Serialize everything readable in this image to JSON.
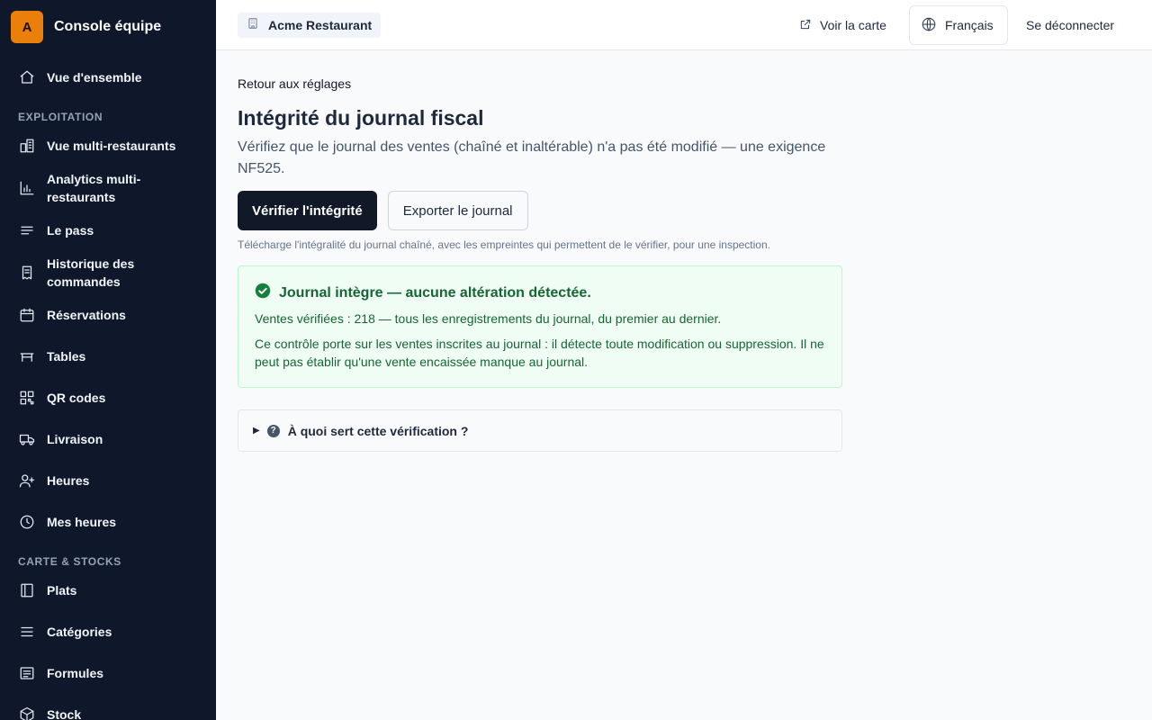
{
  "brand": {
    "logo_letter": "A",
    "name": "Console équipe",
    "logo_color": "#ea7f0c"
  },
  "sidebar": {
    "overview": {
      "label": "Vue d'ensemble",
      "icon": "home-icon"
    },
    "sections": [
      {
        "title": "EXPLOITATION",
        "items": [
          {
            "label": "Vue multi-restaurants",
            "icon": "buildings-icon"
          },
          {
            "label": "Analytics multi-restaurants",
            "icon": "bar-chart-icon"
          },
          {
            "label": "Le pass",
            "icon": "lines-icon"
          },
          {
            "label": "Historique des commandes",
            "icon": "receipt-icon"
          },
          {
            "label": "Réservations",
            "icon": "calendar-icon"
          },
          {
            "label": "Tables",
            "icon": "table-icon"
          },
          {
            "label": "QR codes",
            "icon": "qr-code-icon"
          },
          {
            "label": "Livraison",
            "icon": "truck-icon"
          },
          {
            "label": "Heures",
            "icon": "user-plus-icon"
          },
          {
            "label": "Mes heures",
            "icon": "clock-icon"
          }
        ]
      },
      {
        "title": "CARTE & STOCKS",
        "items": [
          {
            "label": "Plats",
            "icon": "book-icon"
          },
          {
            "label": "Catégories",
            "icon": "menu-icon"
          },
          {
            "label": "Formules",
            "icon": "list-box-icon"
          },
          {
            "label": "Stock",
            "icon": "package-icon"
          }
        ]
      }
    ]
  },
  "header": {
    "restaurant": "Acme Restaurant",
    "view_menu": "Voir la carte",
    "language": "Français",
    "logout": "Se déconnecter"
  },
  "main": {
    "back_link": "Retour aux réglages",
    "title": "Intégrité du journal fiscal",
    "description": "Vérifiez que le journal des ventes (chaîné et inaltérable) n'a pas été modifié — une exigence NF525.",
    "verify_button": "Vérifier l'intégrité",
    "export_button": "Exporter le journal",
    "export_hint": "Télécharge l'intégralité du journal chaîné, avec les empreintes qui permettent de le vérifier, pour une inspection.",
    "result": {
      "title": "Journal intègre — aucune altération détectée.",
      "verified": "Ventes vérifiées : 218 — tous les enregistrements du journal, du premier au dernier.",
      "note": "Ce contrôle porte sur les ventes inscrites au journal : il détecte toute modification ou suppression. Il ne peut pas établir qu'une vente encaissée manque au journal.",
      "status_color": "#166534"
    },
    "faq": {
      "label": "À quoi sert cette vérification ?"
    }
  }
}
